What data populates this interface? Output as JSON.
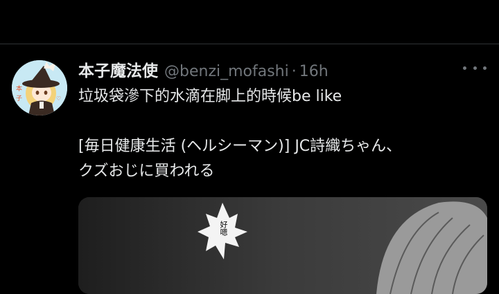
{
  "tweet": {
    "display_name": "本子魔法使",
    "handle": "@benzi_mofashi",
    "separator": "·",
    "time": "16h",
    "more_label": "More",
    "text_line1": "垃圾袋滲下的水滴在脚上的時候be like",
    "text_line2": "[毎日健康生活 (ヘルシーマン)] JC詩織ちゃん、",
    "text_line3": "クズおじに買われる",
    "media": {
      "bubble_text": "好嗯"
    },
    "avatar_icon": "witch-avatar-icon"
  },
  "colors": {
    "background": "#000000",
    "primary_text": "#e7e9ea",
    "secondary_text": "#71767b",
    "divider": "#2f3336"
  }
}
